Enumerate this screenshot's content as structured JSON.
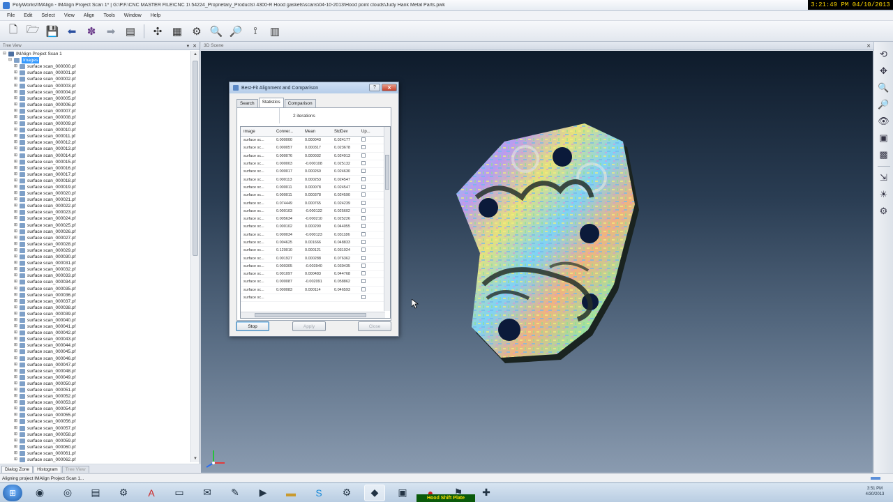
{
  "window": {
    "title": "PolyWorks/IMAlign - IMAlign Project Scan 1* | G:\\P.F.\\CNC MASTER FILE\\CNC 1\\ 54224_Proprietary_Products\\ 4300-R Hood gaskets\\scans\\04-10-2013\\Hood point clouds\\Judy Hank Metal Parts.pwk",
    "overlay_clock": "3:21:49 PM 04/10/2013"
  },
  "menu": [
    "File",
    "Edit",
    "Select",
    "View",
    "Align",
    "Tools",
    "Window",
    "Help"
  ],
  "toolbar": {
    "icons": [
      "new-file-icon",
      "open-folder-icon",
      "save-icon",
      "undo-icon",
      "import-icon",
      "redo-icon",
      "report-icon",
      "split-icon",
      "grid-icon",
      "align-icon",
      "zoom-icon",
      "zoom-select-icon",
      "measure-icon",
      "layers-icon"
    ]
  },
  "left_panel": {
    "header": "Tree View",
    "root": "IMAlign Project Scan 1",
    "selected": "Images",
    "item_prefix": "surface scan_",
    "items": [
      "surface scan_000000.pf",
      "surface scan_000001.pf",
      "surface scan_000002.pf",
      "surface scan_000003.pf",
      "surface scan_000004.pf",
      "surface scan_000005.pf",
      "surface scan_000006.pf",
      "surface scan_000007.pf",
      "surface scan_000008.pf",
      "surface scan_000009.pf",
      "surface scan_000010.pf",
      "surface scan_000011.pf",
      "surface scan_000012.pf",
      "surface scan_000013.pf",
      "surface scan_000014.pf",
      "surface scan_000015.pf",
      "surface scan_000016.pf",
      "surface scan_000017.pf",
      "surface scan_000018.pf",
      "surface scan_000019.pf",
      "surface scan_000020.pf",
      "surface scan_000021.pf",
      "surface scan_000022.pf",
      "surface scan_000023.pf",
      "surface scan_000024.pf",
      "surface scan_000025.pf",
      "surface scan_000026.pf",
      "surface scan_000027.pf",
      "surface scan_000028.pf",
      "surface scan_000029.pf",
      "surface scan_000030.pf",
      "surface scan_000031.pf",
      "surface scan_000032.pf",
      "surface scan_000033.pf",
      "surface scan_000034.pf",
      "surface scan_000035.pf",
      "surface scan_000036.pf",
      "surface scan_000037.pf",
      "surface scan_000038.pf",
      "surface scan_000039.pf",
      "surface scan_000040.pf",
      "surface scan_000041.pf",
      "surface scan_000042.pf",
      "surface scan_000043.pf",
      "surface scan_000044.pf",
      "surface scan_000045.pf",
      "surface scan_000046.pf",
      "surface scan_000047.pf",
      "surface scan_000048.pf",
      "surface scan_000049.pf",
      "surface scan_000050.pf",
      "surface scan_000051.pf",
      "surface scan_000052.pf",
      "surface scan_000053.pf",
      "surface scan_000054.pf",
      "surface scan_000055.pf",
      "surface scan_000056.pf",
      "surface scan_000057.pf",
      "surface scan_000058.pf",
      "surface scan_000059.pf",
      "surface scan_000060.pf",
      "surface scan_000061.pf",
      "surface scan_000062.pf"
    ]
  },
  "bottom_tabs": [
    "Dialog Zone",
    "Histogram",
    "Tree View"
  ],
  "status": "Aligning project IMAlign Project Scan 1...",
  "scene": {
    "header": "3D Scene"
  },
  "dialog": {
    "title": "Best-Fit Alignment and Comparison",
    "tabs": [
      "Search",
      "Statistics",
      "Comparison"
    ],
    "active_tab": "Statistics",
    "iterations": "2 iterations",
    "columns": [
      "Image",
      "Conver...",
      "Mean",
      "StdDev",
      "Up..."
    ],
    "rows": [
      [
        "surface sc...",
        "0.000000",
        "0.000043",
        "0.024177"
      ],
      [
        "surface sc...",
        "0.000057",
        "0.000317",
        "0.023678"
      ],
      [
        "surface sc...",
        "0.000076",
        "0.000032",
        "0.024913"
      ],
      [
        "surface sc...",
        "0.000003",
        "-0.000108",
        "0.025132"
      ],
      [
        "surface sc...",
        "0.000017",
        "0.000260",
        "0.024630"
      ],
      [
        "surface sc...",
        "0.000113",
        "0.000253",
        "0.024547"
      ],
      [
        "surface sc...",
        "0.000011",
        "0.000078",
        "0.024547"
      ],
      [
        "surface sc...",
        "0.000011",
        "0.000378",
        "0.024590"
      ],
      [
        "surface sc...",
        "0.074449",
        "0.000765",
        "0.024239"
      ],
      [
        "surface sc...",
        "0.000103",
        "-0.000132",
        "0.025602"
      ],
      [
        "surface sc...",
        "0.005634",
        "-0.000210",
        "0.025226"
      ],
      [
        "surface sc...",
        "0.000102",
        "0.000290",
        "0.044055"
      ],
      [
        "surface sc...",
        "0.000034",
        "-0.000123",
        "0.031186"
      ],
      [
        "surface sc...",
        "0.004625",
        "0.001666",
        "0.048833"
      ],
      [
        "surface sc...",
        "0.120010",
        "0.000121",
        "0.031024"
      ],
      [
        "surface sc...",
        "0.001927",
        "0.000288",
        "0.076362"
      ],
      [
        "surface sc...",
        "0.000305",
        "-0.003940",
        "0.039435"
      ],
      [
        "surface sc...",
        "0.001097",
        "0.000483",
        "0.044768"
      ],
      [
        "surface sc...",
        "0.000087",
        "-0.002091",
        "0.058862"
      ],
      [
        "surface sc...",
        "0.000083",
        "0.000114",
        "0.046593"
      ],
      [
        "surface sc...",
        "",
        "",
        ""
      ]
    ],
    "buttons": {
      "stop": "Stop",
      "apply": "Apply",
      "close": "Close"
    }
  },
  "taskbar": {
    "label": "Hood Shift Plate",
    "clock_time": "3:51 PM",
    "clock_date": "4/30/2013"
  }
}
